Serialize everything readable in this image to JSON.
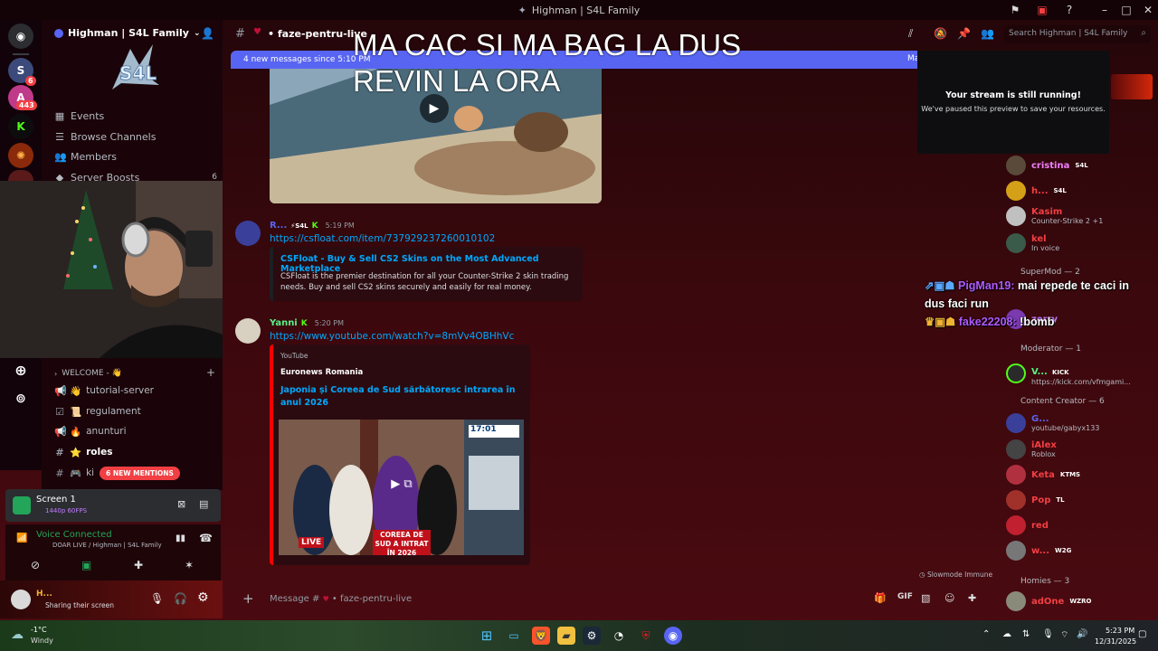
{
  "window": {
    "title": "Highman | S4L Family"
  },
  "overlay": {
    "line1": "MA CAC SI MA BAG LA DUS",
    "line2": "REVIN LA ORA"
  },
  "rail": {
    "badges": [
      "6",
      "443"
    ]
  },
  "server": {
    "name": "Highman | S4L Family"
  },
  "sidebar": {
    "items": [
      {
        "label": "Events",
        "icon": "calendar-icon"
      },
      {
        "label": "Browse Channels",
        "icon": "channels-icon"
      },
      {
        "label": "Members",
        "icon": "members-icon"
      },
      {
        "label": "Server Boosts",
        "icon": "boost-icon",
        "count": "6"
      }
    ],
    "category": "WELCOME - 👋",
    "channels": [
      {
        "label": "tutorial-server",
        "emoji": "👋"
      },
      {
        "label": "regulament",
        "emoji": "📜"
      },
      {
        "label": "anunturi",
        "emoji": "🔥"
      },
      {
        "label": "roles",
        "emoji": "⭐"
      },
      {
        "label": "ki",
        "emoji": "🎮"
      }
    ],
    "mentions_badge": "6 NEW MENTIONS"
  },
  "screen_share": {
    "title": "Screen 1",
    "quality": "1440p 60FPS"
  },
  "voice": {
    "status": "Voice Connected",
    "channel": "DOAR LIVE / Highman | S4L Family"
  },
  "user": {
    "name": "H...",
    "status": "Sharing their screen"
  },
  "channel": {
    "name": "faze-pentru-live",
    "search_placeholder": "Search Highman | S4L Family"
  },
  "new_messages": {
    "text": "4 new messages since 5:10 PM",
    "mark": "Ma"
  },
  "messages": [
    {
      "author": "R...",
      "tag": "S4L",
      "time": "5:19 PM",
      "link": "https://csfloat.com/item/737929237260010102",
      "embed": {
        "title": "CSFloat - Buy & Sell CS2 Skins on the Most Advanced Marketplace",
        "description": "CSFloat is the premier destination for all your Counter-Strike 2 skin trading needs. Buy and sell CS2 skins securely and easily for real money."
      }
    },
    {
      "author": "Yanni",
      "time": "5:20 PM",
      "link": "https://www.youtube.com/watch?v=8mVv4OBHhVc",
      "embed": {
        "provider": "YouTube",
        "author": "Euronews Romania",
        "title": "Japonia și Coreea de Sud sărbătoresc intrarea în anul 2026",
        "thumb_time": "17:01",
        "thumb_caption": "COREEA DE SUD A INTRAT ÎN 2026",
        "thumb_live": "LIVE"
      }
    }
  ],
  "composer": {
    "placeholder": "Message #",
    "channel": "faze-pentru-live",
    "slowmode": "Slowmode Immune"
  },
  "stream_notice": {
    "title": "Your stream is still running!",
    "body": "We've paused this preview to save your resources."
  },
  "chat_overlay": {
    "user1": "PigMan19:",
    "text1": "mai repede te caci in dus faci run",
    "user2": "fake22208:",
    "text2": "!bomb"
  },
  "members": {
    "top": [
      {
        "name": "cristina",
        "tag": "S4L",
        "color": "#f47fff"
      },
      {
        "name": "h...",
        "tag": "S4L",
        "color": "#f23f43"
      },
      {
        "name": "Kasim",
        "sub": "Counter-Strike 2 +1",
        "color": "#f23f43"
      },
      {
        "name": "kel",
        "sub": "In voice",
        "color": "#f23f43"
      }
    ],
    "supermod_header": "SuperMod — 2",
    "supermod": [
      {
        "name": "zerry",
        "color": "#c27cff"
      }
    ],
    "moderator_header": "Moderator — 1",
    "moderator": [
      {
        "name": "V...",
        "tag": "KICK",
        "sub": "https://kick.com/vfmgami...",
        "color": "#57f287"
      }
    ],
    "creator_header": "Content Creator — 6",
    "creators": [
      {
        "name": "G...",
        "sub": "youtube/gabyx133",
        "color": "#5865f2"
      },
      {
        "name": "iAlex",
        "sub": "Roblox",
        "color": "#f23f43"
      },
      {
        "name": "Keta",
        "tag": "KTMS",
        "color": "#f23f43"
      },
      {
        "name": "Pop",
        "tag": "TL",
        "color": "#f23f43"
      },
      {
        "name": "red",
        "color": "#f23f43"
      },
      {
        "name": "w...",
        "tag": "W2G",
        "color": "#f23f43"
      }
    ],
    "homies_header": "Homies — 3",
    "homies": [
      {
        "name": "adOne",
        "tag": "WZRO",
        "color": "#f23f43"
      }
    ]
  },
  "taskbar": {
    "temp": "-1°C",
    "weather": "Windy",
    "time": "5:23 PM",
    "date": "12/31/2025"
  }
}
